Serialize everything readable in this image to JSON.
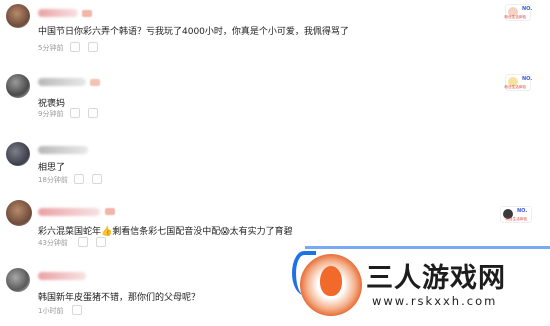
{
  "comments": [
    {
      "text": "中国节日你彩六弄个韩语？亏我玩了4000小时，你真是个小可爱，我佩得骂了",
      "time": "5分钟前"
    },
    {
      "text": "祝褒妈",
      "time": "9分钟前"
    },
    {
      "text": "相思了",
      "time": "18分钟前"
    },
    {
      "text_a": "彩六混菜国蛇年",
      "emoji_a": "👍",
      "text_b": "剩看信条彩七国配音没中配",
      "emoji_b": "😱",
      "text_c": "太有实力了育碧",
      "time": "43分钟前"
    },
    {
      "text": "韩国新年皮蛋猪不错，那你们的父母呢？",
      "time": "1小时前"
    }
  ],
  "stickers": [
    {
      "tag": "NO.",
      "caption": "粉丝生活体验"
    },
    {
      "tag": "NO.",
      "caption": "粉丝生活体验"
    },
    {
      "tag": "NO.",
      "caption": "粉丝生活体验"
    }
  ],
  "watermark": {
    "brand": "三人游戏网",
    "url": "www.rskxxh.com"
  }
}
